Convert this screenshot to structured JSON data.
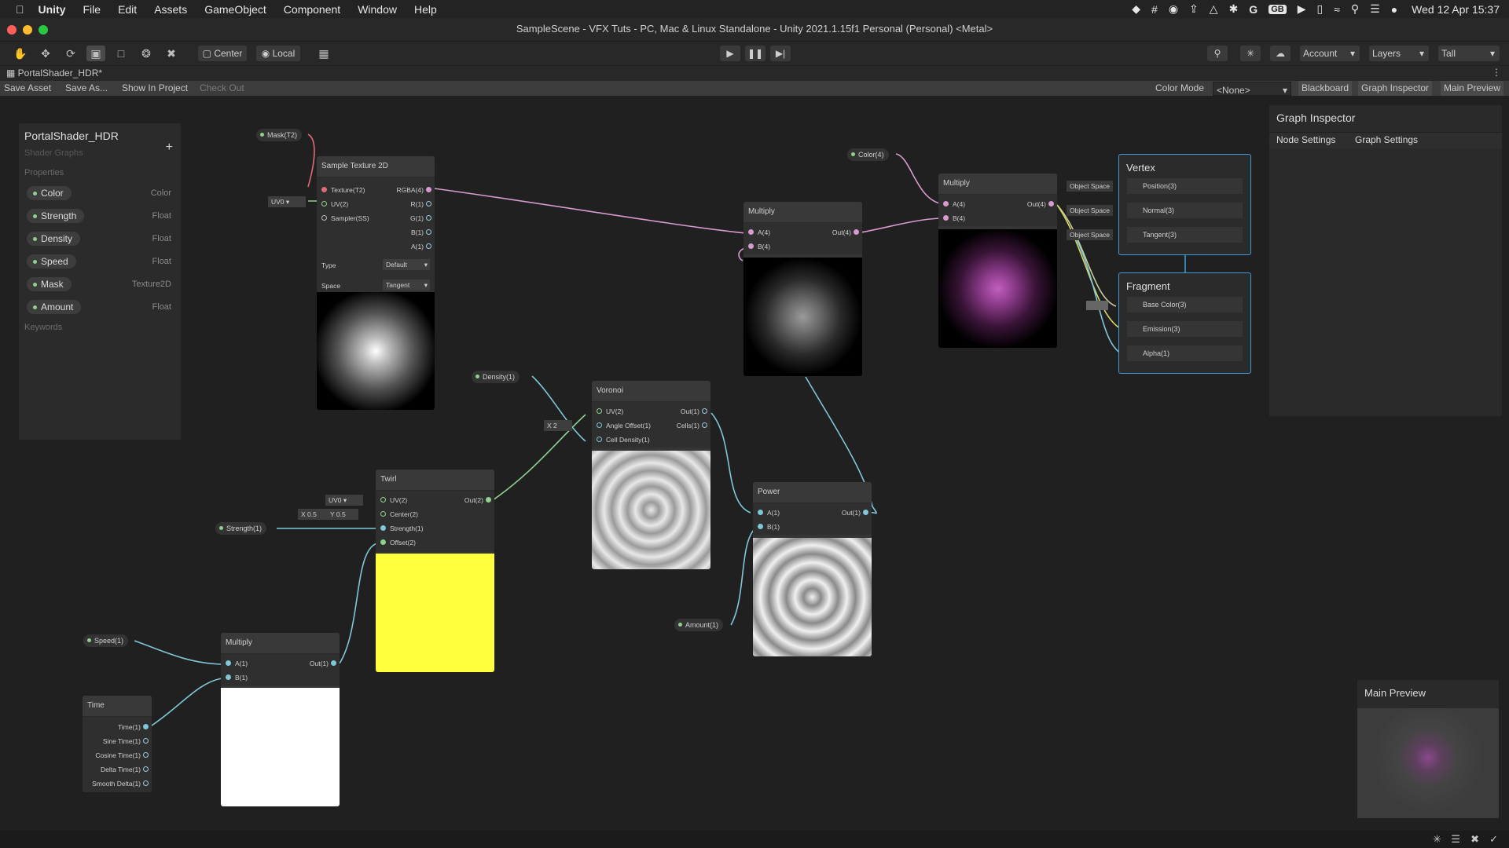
{
  "menubar": {
    "app": "Unity",
    "items": [
      "File",
      "Edit",
      "Assets",
      "GameObject",
      "Component",
      "Window",
      "Help"
    ],
    "keyboard": "GB",
    "clock": "Wed 12 Apr  15:37"
  },
  "window": {
    "title": "SampleScene - VFX Tuts - PC, Mac & Linux Standalone - Unity 2021.1.15f1 Personal (Personal) <Metal>"
  },
  "toolbar": {
    "center_label": "Center",
    "local_label": "Local",
    "account_label": "Account",
    "layers_label": "Layers",
    "layout_label": "Tall"
  },
  "tab": {
    "label": "PortalShader_HDR*"
  },
  "assetbar": {
    "save_asset": "Save Asset",
    "save_as": "Save As...",
    "show_in_project": "Show In Project",
    "check_out": "Check Out",
    "color_mode_label": "Color Mode",
    "color_mode_value": "<None>",
    "blackboard": "Blackboard",
    "graph_inspector": "Graph Inspector",
    "main_preview": "Main Preview"
  },
  "blackboard": {
    "title": "PortalShader_HDR",
    "subtitle": "Shader Graphs",
    "properties_label": "Properties",
    "keywords_label": "Keywords",
    "properties": [
      {
        "name": "Color",
        "type": "Color"
      },
      {
        "name": "Strength",
        "type": "Float"
      },
      {
        "name": "Density",
        "type": "Float"
      },
      {
        "name": "Speed",
        "type": "Float"
      },
      {
        "name": "Mask",
        "type": "Texture2D"
      },
      {
        "name": "Amount",
        "type": "Float"
      }
    ]
  },
  "nodes": {
    "mask_pill": "Mask(T2)",
    "color_pill": "Color(4)",
    "density_pill": "Density(1)",
    "strength_pill": "Strength(1)",
    "speed_pill": "Speed(1)",
    "amount_pill": "Amount(1)",
    "sample_texture": {
      "title": "Sample Texture 2D",
      "inputs": [
        "Texture(T2)",
        "UV(2)",
        "Sampler(SS)"
      ],
      "outputs": [
        "RGBA(4)",
        "R(1)",
        "G(1)",
        "B(1)",
        "A(1)"
      ],
      "uv_default": "UV0",
      "type_label": "Type",
      "type_value": "Default",
      "space_label": "Space",
      "space_value": "Tangent"
    },
    "multiply_a": {
      "title": "Multiply",
      "inputs": [
        "A(4)",
        "B(4)"
      ],
      "output": "Out(4)"
    },
    "multiply_b": {
      "title": "Multiply",
      "inputs": [
        "A(4)",
        "B(4)"
      ],
      "output": "Out(4)"
    },
    "voronoi": {
      "title": "Voronoi",
      "inputs": [
        "UV(2)",
        "Angle Offset(1)",
        "Cell Density(1)"
      ],
      "outputs": [
        "Out(1)",
        "Cells(1)"
      ],
      "angle_x_label": "X",
      "angle_x_value": "2"
    },
    "twirl": {
      "title": "Twirl",
      "inputs": [
        "UV(2)",
        "Center(2)",
        "Strength(1)",
        "Offset(2)"
      ],
      "output": "Out(2)",
      "uv_default": "UV0",
      "center_x_label": "X",
      "center_x": "0.5",
      "center_y_label": "Y",
      "center_y": "0.5"
    },
    "power": {
      "title": "Power",
      "inputs": [
        "A(1)",
        "B(1)"
      ],
      "output": "Out(1)"
    },
    "multiply_c": {
      "title": "Multiply",
      "inputs": [
        "A(1)",
        "B(1)"
      ],
      "output": "Out(1)"
    },
    "time": {
      "title": "Time",
      "outputs": [
        "Time(1)",
        "Sine Time(1)",
        "Cosine Time(1)",
        "Delta Time(1)",
        "Smooth Delta(1)"
      ]
    },
    "vertex": {
      "title": "Vertex",
      "rows": [
        "Position(3)",
        "Normal(3)",
        "Tangent(3)"
      ],
      "space_label": "Object Space"
    },
    "fragment": {
      "title": "Fragment",
      "rows": [
        "Base Color(3)",
        "Emission(3)",
        "Alpha(1)"
      ]
    }
  },
  "inspector": {
    "title": "Graph Inspector",
    "tabs": [
      "Node Settings",
      "Graph Settings"
    ]
  },
  "main_preview": {
    "title": "Main Preview"
  },
  "colors": {
    "accent_blue": "#3e9bd6",
    "wire_pink": "#d89ad0",
    "wire_cyan": "#7fc7d9",
    "wire_green": "#8fd18f",
    "twirl_yellow": "#ffff3c"
  }
}
